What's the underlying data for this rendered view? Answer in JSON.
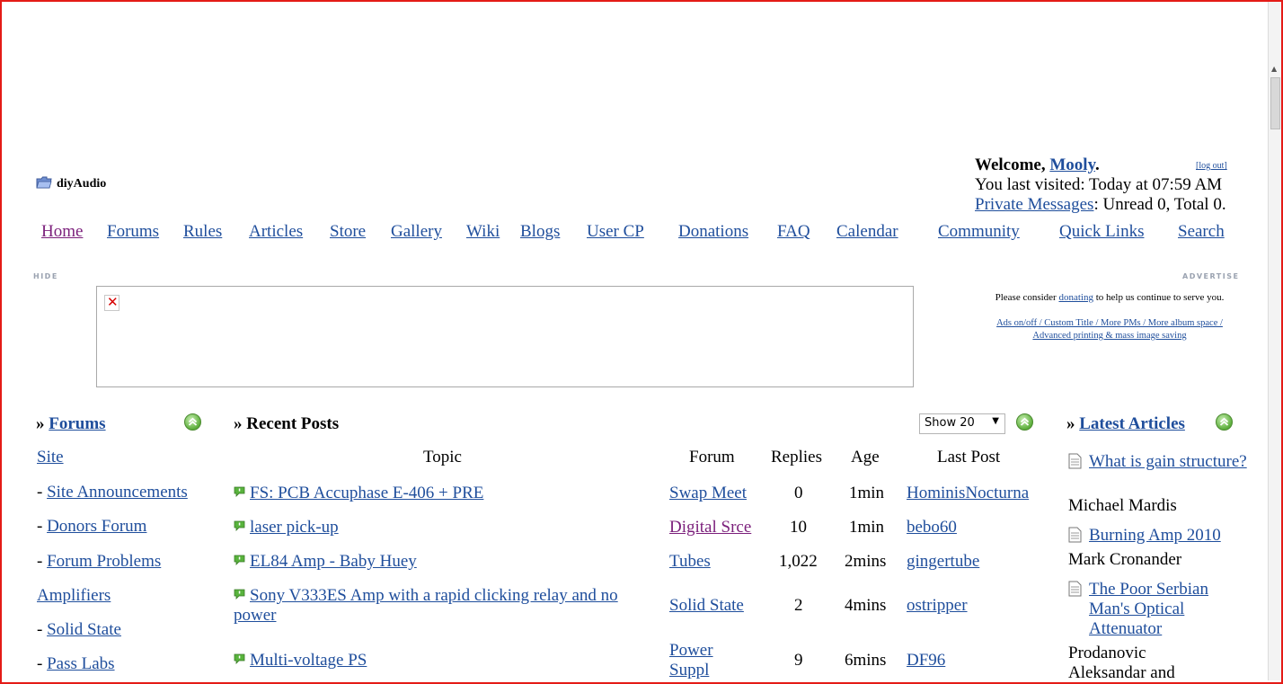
{
  "site": {
    "logo_text": "diyAudio"
  },
  "welcome": {
    "greeting": "Welcome, ",
    "username": "Mooly",
    "period": ".",
    "logout": "[log out]",
    "last_visited": "You last visited: Today at 07:59 AM",
    "pm_link": "Private Messages",
    "pm_status": ": Unread 0, Total 0."
  },
  "nav": [
    "Home",
    "Forums",
    "Rules",
    "Articles",
    "Store",
    "Gallery",
    "Wiki",
    "Blogs",
    "User CP",
    "Donations",
    "FAQ",
    "Calendar",
    "Community",
    "Quick Links",
    "Search"
  ],
  "ads": {
    "hide": "HIDE",
    "advertise": "ADVERTISE",
    "donate_pre": "Please consider ",
    "donate_link": "donating",
    "donate_post": " to help us continue to serve you.",
    "options_line1": "Ads on/off / Custom Title / More PMs / More album space /",
    "options_line2": "Advanced printing & mass image saving"
  },
  "forums_panel": {
    "prefix": "» ",
    "title": "Forums",
    "items": [
      {
        "dash": "",
        "label": "Site"
      },
      {
        "dash": "- ",
        "label": "Site Announcements"
      },
      {
        "dash": "- ",
        "label": "Donors Forum"
      },
      {
        "dash": "- ",
        "label": "Forum Problems"
      },
      {
        "dash": "",
        "label": "Amplifiers"
      },
      {
        "dash": "- ",
        "label": "Solid State"
      },
      {
        "dash": "- ",
        "label": "Pass Labs"
      }
    ]
  },
  "recent_posts": {
    "prefix": "» ",
    "title": "Recent Posts",
    "show_select": "Show 20",
    "columns": {
      "topic": "Topic",
      "forum": "Forum",
      "replies": "Replies",
      "age": "Age",
      "last_post": "Last Post"
    },
    "rows": [
      {
        "topic": "FS: PCB Accuphase E-406 + PRE",
        "forum": "Swap Meet",
        "replies": "0",
        "age": "1min",
        "last_post": "HominisNocturna"
      },
      {
        "topic": "laser pick-up",
        "forum": "Digital Srce",
        "replies": "10",
        "age": "1min",
        "last_post": "bebo60"
      },
      {
        "topic": "EL84 Amp - Baby Huey",
        "forum": "Tubes",
        "replies": "1,022",
        "age": "2mins",
        "last_post": "gingertube"
      },
      {
        "topic": "Sony V333ES Amp with a rapid clicking relay and no power",
        "forum": "Solid State",
        "replies": "2",
        "age": "4mins",
        "last_post": "ostripper"
      },
      {
        "topic": "Multi-voltage PS",
        "forum": "Power Suppl",
        "replies": "9",
        "age": "6mins",
        "last_post": "DF96"
      }
    ]
  },
  "latest_articles": {
    "prefix": "» ",
    "title": "Latest Articles",
    "items": [
      {
        "title": "What is gain structure?",
        "author": "Michael Mardis"
      },
      {
        "title": "Burning Amp 2010",
        "author": "Mark Cronander"
      },
      {
        "title": "The Poor Serbian Man's Optical Attenuator",
        "author": "Prodanovic Aleksandar and"
      }
    ]
  }
}
